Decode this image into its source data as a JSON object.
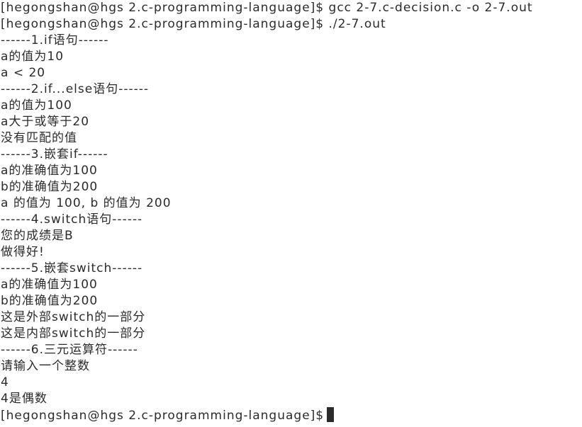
{
  "terminal": {
    "lines": [
      "[hegongshan@hgs 2.c-programming-language]$ gcc 2-7.c-decision.c -o 2-7.out",
      "[hegongshan@hgs 2.c-programming-language]$ ./2-7.out",
      "------1.if语句------",
      "a的值为10",
      "a < 20",
      "------2.if...else语句------",
      "a的值为100",
      "a大于或等于20",
      "没有匹配的值",
      "------3.嵌套if------",
      "a的准确值为100",
      "b的准确值为200",
      "a 的值为 100, b 的值为 200",
      "------4.switch语句------",
      "您的成绩是B",
      "做得好!",
      "------5.嵌套switch------",
      "a的准确值为100",
      "b的准确值为200",
      "这是外部switch的一部分",
      "这是内部switch的一部分",
      "------6.三元运算符------",
      "请输入一个整数",
      "4",
      "4是偶数"
    ],
    "prompt": "[hegongshan@hgs 2.c-programming-language]$",
    "cursor_color": "#2b2b2b",
    "text_color": "#2b2b2b",
    "background": "#ffffff"
  }
}
